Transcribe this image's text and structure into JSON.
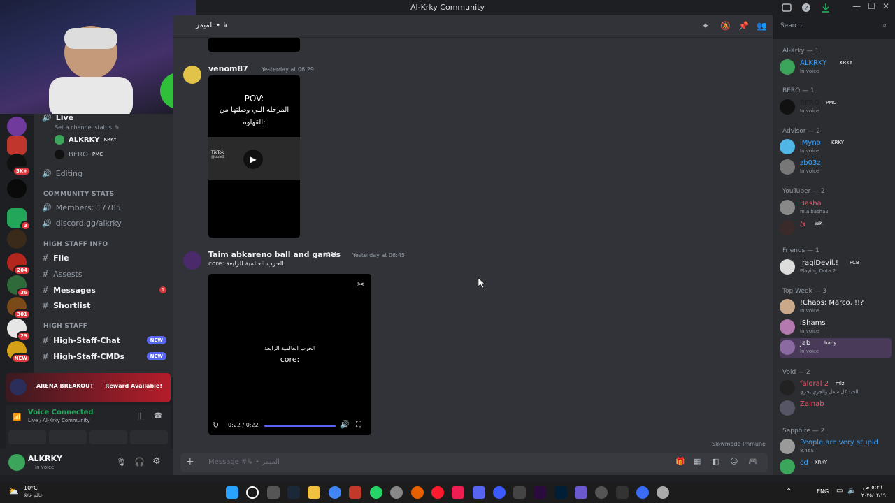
{
  "window": {
    "title": "Al-Krky Community"
  },
  "header": {
    "channel": "‪الميمز • ↳‬",
    "search_placeholder": "Search"
  },
  "servers": [
    {
      "badge": ""
    },
    {
      "badge": ""
    },
    {
      "badge": "5K+"
    },
    {
      "badge": ""
    },
    {
      "badge": "3"
    },
    {
      "badge": ""
    },
    {
      "badge": "204"
    },
    {
      "badge": "36"
    },
    {
      "badge": "301"
    },
    {
      "badge": "29"
    },
    {
      "badge": "NEW"
    }
  ],
  "sidebar": {
    "live_label": "Live",
    "status_label": "Set a channel status",
    "voice_users": [
      {
        "name": "ALKRKY",
        "tag": "KRKY"
      },
      {
        "name": "BERO",
        "tag": "PMC"
      }
    ],
    "editing_label": "Editing",
    "cat_community": "COMMUNITY STATS",
    "members_count": "Members: 17785",
    "invite": "discord.gg/alkrky",
    "cat_high_staff_info": "HIGH STAFF INFO",
    "file": "File",
    "assests": "Assests",
    "messages": "Messages",
    "messages_badge": "1",
    "shortlist": "Shortlist",
    "cat_high_staff": "HIGH STAFF",
    "hs_chat": "High-Staff-Chat",
    "hs_cmds": "High-Staff-CMDs",
    "new_label": "NEW"
  },
  "promo": {
    "brand": "ARENA BREAKOUT",
    "cta": "Reward Available!"
  },
  "voice": {
    "status": "Voice Connected",
    "location": "Live / Al-Krky Community"
  },
  "user": {
    "name": "ALKRKY",
    "status": "In voice"
  },
  "messages": [
    {
      "author": "venom87",
      "time": "Yesterday at 06:29",
      "video_text_1": "POV:",
      "video_text_2": "المرحله اللي وصلتها من",
      "video_text_3": "القهاوه:",
      "video_brand": "TikTok",
      "video_handle": "@bbie2"
    },
    {
      "author": "Taim abkareno ball and games",
      "tag": "+964",
      "time": "Yesterday at 06:45",
      "content": "core: الحرب العالمية الرابعة",
      "video_line_1": "الحرب العالمية الرابعة",
      "video_line_2": "core:",
      "video_time": "0:22 / 0:22",
      "progress": 1.0
    }
  ],
  "slowmode": "Slowmode Immune",
  "composer_placeholder": "Message #↳ • الميمز",
  "members": {
    "groups": [
      {
        "label": "Al-Krky — 1",
        "items": [
          {
            "name": "ALKRKY",
            "tag": "KRKY",
            "status": "In voice",
            "color": "#3ba2ff"
          }
        ]
      },
      {
        "label": "BERO — 1",
        "items": [
          {
            "name": "BERO",
            "tag": "PMC",
            "status": "In voice",
            "color": "#1e1f22"
          }
        ]
      },
      {
        "label": "Advisor — 2",
        "items": [
          {
            "name": "iMyno",
            "tag": "KRKY",
            "status": "In voice",
            "color": "#3ba2ff"
          },
          {
            "name": "zb03z",
            "tag": "",
            "status": "In voice",
            "color": "#3ba2ff"
          }
        ]
      },
      {
        "label": "YouTuber — 2",
        "items": [
          {
            "name": "Basha",
            "tag": "",
            "status": "m.albasha2",
            "color": "#f2576c"
          },
          {
            "name": "ئ",
            "tag": "WK",
            "status": "",
            "color": "#f2576c"
          }
        ]
      },
      {
        "label": "Friends — 1",
        "items": [
          {
            "name": "IraqiDevil.!",
            "tag": "FCB",
            "status": "Playing Dota 2",
            "color": "#f2f3f5"
          }
        ]
      },
      {
        "label": "Top Week — 3",
        "items": [
          {
            "name": "!Chaos; Marco, !!?",
            "tag": "",
            "status": "In voice",
            "color": "#f2f3f5"
          },
          {
            "name": "iShams",
            "tag": "",
            "status": "In voice",
            "color": "#f2f3f5"
          },
          {
            "name": "jab",
            "tag": "baby",
            "status": "In voice",
            "color": "#f2f3f5"
          }
        ]
      },
      {
        "label": "Void — 2",
        "items": [
          {
            "name": "faloral 2",
            "tag": "mlz",
            "status": "الجيد كل شعل والجري يجري",
            "color": "#f2576c"
          },
          {
            "name": "Zainab",
            "tag": "",
            "status": "",
            "color": "#f2576c"
          }
        ]
      },
      {
        "label": "Sapphire — 2",
        "items": [
          {
            "name": "People are very stupid",
            "tag": "",
            "status": "8.46$",
            "color": "#3ba2ff"
          },
          {
            "name": "cd",
            "tag": "KRKY",
            "status": "",
            "color": "#3ba2ff"
          }
        ]
      }
    ]
  },
  "taskbar": {
    "weather": "10°C",
    "weather_sub": "عالم غائلا",
    "lang": "ENG",
    "time": "٥:٣٦ ص",
    "date": "٢٠٢٥/٠٢/١٩"
  }
}
